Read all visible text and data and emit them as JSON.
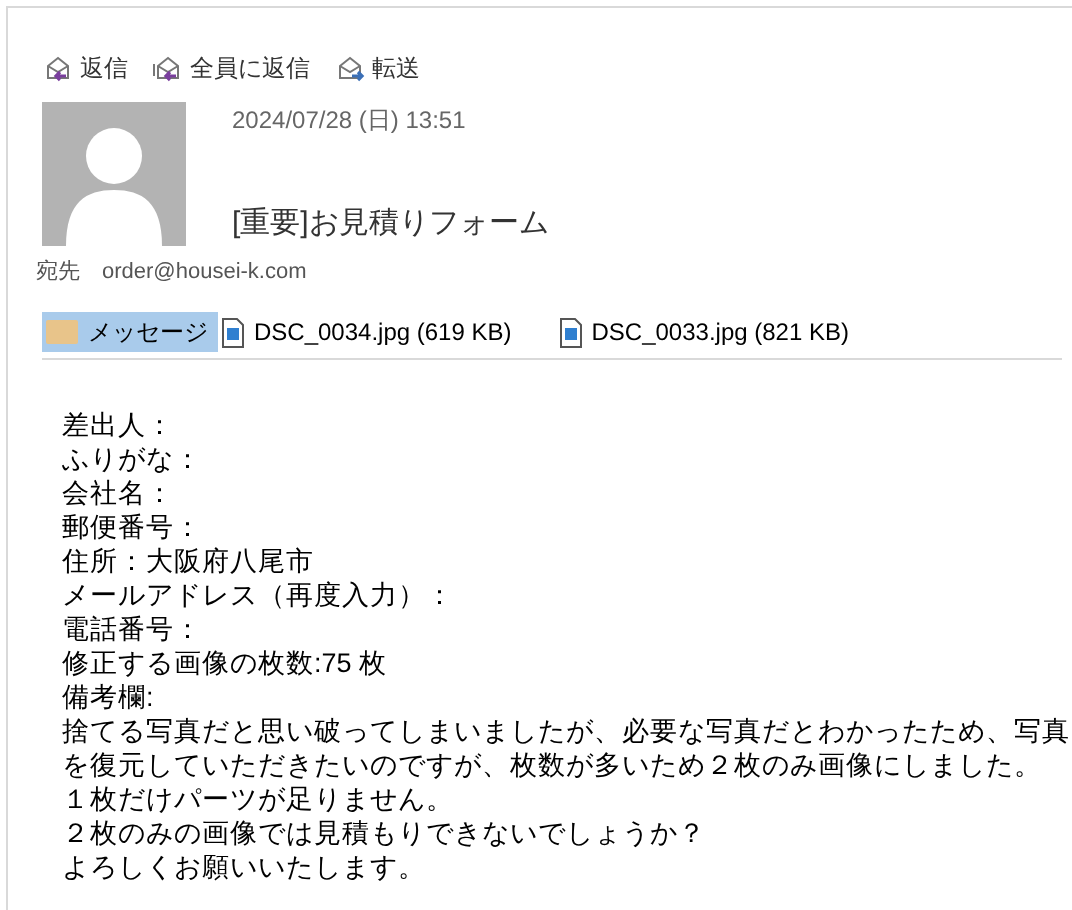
{
  "toolbar": [
    {
      "label": "返信",
      "kind": "reply"
    },
    {
      "label": "全員に返信",
      "kind": "reply_all"
    },
    {
      "label": "転送",
      "kind": "forward"
    }
  ],
  "header": {
    "date": "2024/07/28 (日) 13:51",
    "subject": "[重要]お見積りフォーム",
    "to_label": "宛先",
    "to": "order@housei-k.com"
  },
  "attachments": [
    {
      "label": "メッセージ",
      "kind": "message",
      "selected": true
    },
    {
      "label": "DSC_0034.jpg (619 KB)",
      "kind": "image",
      "selected": false
    },
    {
      "label": "DSC_0033.jpg (821 KB)",
      "kind": "image",
      "selected": false
    }
  ],
  "body": [
    "差出人：",
    "ふりがな：",
    "会社名：",
    "郵便番号：",
    "住所：大阪府八尾市",
    "メールアドレス（再度入力）：",
    "電話番号：",
    "修正する画像の枚数:75 枚",
    "備考欄:",
    "捨てる写真だと思い破ってしまいましたが、必要な写真だとわかったため、写真を復元していただきたいのですが、枚数が多いため２枚のみ画像にしました。",
    "１枚だけパーツが足りません。",
    "２枚のみの画像では見積もりできないでしょうか？",
    "よろしくお願いいたします。"
  ]
}
